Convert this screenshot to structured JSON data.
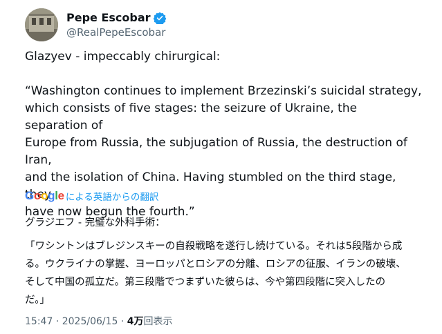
{
  "author": {
    "display_name": "Pepe Escobar",
    "handle": "@RealPepeEscobar",
    "verified_icon": "verified-badge-icon",
    "verified_color": "#1d9bf0"
  },
  "tweet": {
    "line_intro": "Glazyev - impeccably chirurgical:",
    "quote_lines": [
      "“Washington continues to implement Brzezinski’s suicidal strategy,",
      "which consists of five stages: the seizure of Ukraine, the separation of",
      "Europe from Russia, the subjugation of Russia, the destruction of Iran,",
      "and the isolation of China. Having stumbled on the third stage, they",
      "have now begun the fourth.”"
    ]
  },
  "translation": {
    "provider": "Google",
    "label": "による英語からの翻訳",
    "heading": "グラジエフ - 完璧な外科手術：",
    "lines": [
      "「ワシントンはブレジンスキーの自殺戦略を遂行し続けている。それは5段階から成",
      "る。ウクライナの掌握、ヨーロッパとロシアの分離、ロシアの征服、イランの破壊、",
      "そして中国の孤立だ。第三段階でつまずいた彼らは、今や第四段階に突入したの",
      "だ。」"
    ]
  },
  "meta": {
    "time": "15:47",
    "separator": "·",
    "date": "2025/06/15",
    "views_count": "4万",
    "views_label": "回表示"
  }
}
